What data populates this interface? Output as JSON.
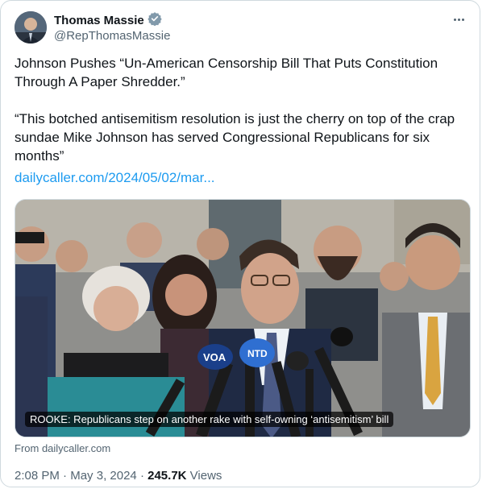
{
  "author": {
    "name": "Thomas Massie",
    "handle": "@RepThomasMassie",
    "verified_color": "#829aab"
  },
  "tweet": {
    "text": "Johnson Pushes “Un-American Censorship Bill That Puts Constitution Through A Paper Shredder.”\n\n“This botched antisemitism resolution is just the cherry on top of the crap sundae Mike Johnson has served Congressional Republicans for six months”",
    "link": "dailycaller.com/2024/05/02/mar..."
  },
  "media": {
    "caption": "ROOKE: Republicans step on another rake with self-owning ‘antisemitism’ bill",
    "mic_labels": [
      "VOA",
      "NTD"
    ]
  },
  "card_source": "From dailycaller.com",
  "meta": {
    "time": "2:08 PM",
    "dot": "·",
    "date": "May 3, 2024",
    "views_count": "245.7K",
    "views_label": "Views"
  },
  "colors": {
    "link": "#1d9bf0",
    "secondary_text": "#536471"
  },
  "icons": {
    "verified": "verified-badge-icon",
    "more": "more-options-icon"
  }
}
